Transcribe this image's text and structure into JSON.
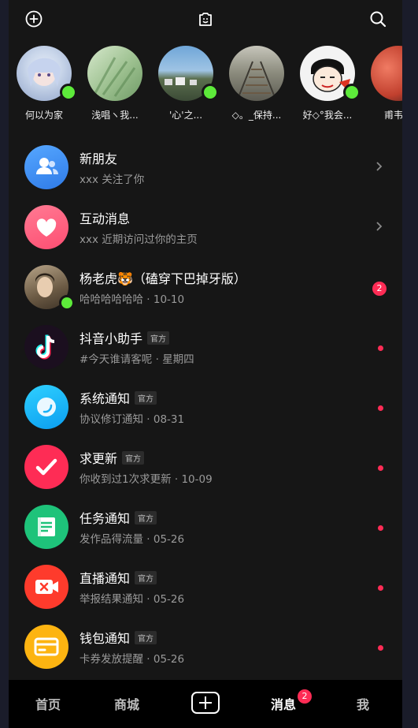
{
  "top_bar": {
    "add_icon": "plus-circle-icon",
    "center_icon": "face-camera-icon",
    "search_icon": "search-icon"
  },
  "stories": [
    {
      "name": "何以为家",
      "online": true,
      "colors": [
        "#c9d6ea",
        "#8fa3c9"
      ]
    },
    {
      "name": "浅唱ヽ我...",
      "online": false,
      "colors": [
        "#b9d7b0",
        "#7fa878"
      ]
    },
    {
      "name": "'心'之...",
      "online": true,
      "colors": [
        "#8ab6dd",
        "#5a6b53"
      ]
    },
    {
      "name": "◇。_保持...",
      "online": false,
      "colors": [
        "#7d7f74",
        "#b6b4a8"
      ]
    },
    {
      "name": "好◇°我会...",
      "online": true,
      "colors": [
        "#f3f3f3",
        "#c9c9c9"
      ]
    },
    {
      "name": "甫韦刻",
      "online": false,
      "colors": [
        "#e4604f",
        "#2b1a1a"
      ]
    }
  ],
  "messages": [
    {
      "title": "新朋友",
      "subtitle": "xxx 关注了你",
      "tag": "",
      "time": "",
      "icon": "people-icon",
      "color": "#3b8cf6",
      "right": "chevron"
    },
    {
      "title": "互动消息",
      "subtitle": "xxx 近期访问过你的主页",
      "tag": "",
      "time": "",
      "icon": "heart-icon",
      "color": "#fe5a7c",
      "right": "chevron"
    },
    {
      "title": "杨老虎🐯（磕穿下巴掉牙版）",
      "subtitle": "哈哈哈哈哈哈",
      "tag": "",
      "time": "10-10",
      "icon": "user-avatar",
      "color": "#7b6a52",
      "right": "badge",
      "badge": "2"
    },
    {
      "title": "抖音小助手",
      "subtitle": "#今天谁请客呢",
      "tag": "官方",
      "time": "星期四",
      "icon": "tiktok-logo-icon",
      "color": "#1a1020",
      "right": "dot"
    },
    {
      "title": "系统通知",
      "subtitle": "协议修订通知",
      "tag": "官方",
      "time": "08-31",
      "icon": "moon-icon",
      "color": "#16b8f2",
      "right": "dot"
    },
    {
      "title": "求更新",
      "subtitle": "你收到过1次求更新",
      "tag": "官方",
      "time": "10-09",
      "icon": "check-icon",
      "color": "#fe2c55",
      "right": "dot"
    },
    {
      "title": "任务通知",
      "subtitle": "发作品得流量",
      "tag": "官方",
      "time": "05-26",
      "icon": "document-icon",
      "color": "#22c47a",
      "right": "dot"
    },
    {
      "title": "直播通知",
      "subtitle": "举报结果通知",
      "tag": "官方",
      "time": "05-26",
      "icon": "live-camera-icon",
      "color": "#fe3a2c",
      "right": "dot"
    },
    {
      "title": "钱包通知",
      "subtitle": "卡券发放提醒",
      "tag": "官方",
      "time": "05-26",
      "icon": "wallet-icon",
      "color": "#fdb411",
      "right": "dot"
    }
  ],
  "bottom_nav": {
    "home": "首页",
    "mall": "商城",
    "create": "+",
    "messages": "消息",
    "messages_badge": "2",
    "me": "我"
  }
}
